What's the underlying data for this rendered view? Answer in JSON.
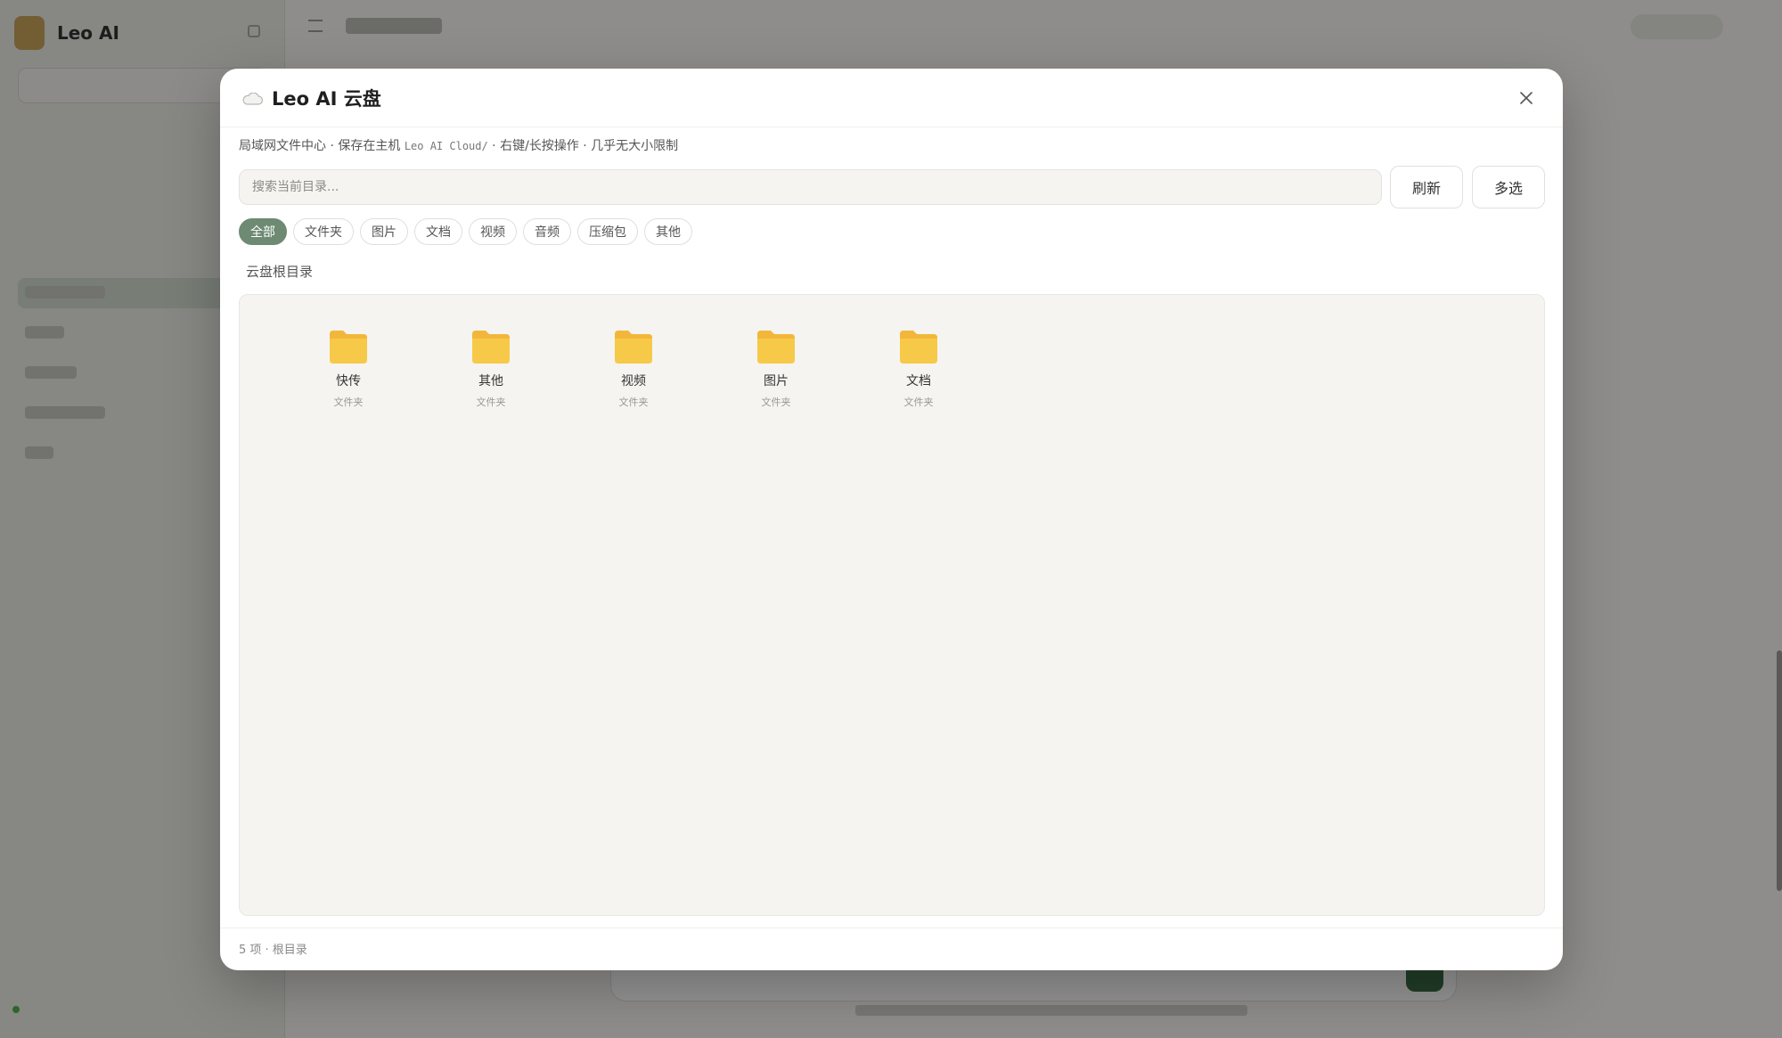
{
  "modal": {
    "title": "Leo AI 云盘",
    "subtitle_prefix": "局域网文件中心 · 保存在主机 ",
    "subtitle_path": "Leo AI Cloud/",
    "subtitle_suffix": " · 右键/长按操作 · 几乎无大小限制",
    "search": {
      "placeholder": "搜索当前目录...",
      "value": ""
    },
    "refresh_label": "刷新",
    "multi_select_label": "多选",
    "filters": [
      "全部",
      "文件夹",
      "图片",
      "文档",
      "视频",
      "音频",
      "压缩包",
      "其他"
    ],
    "active_filter": "全部",
    "breadcrumb": "云盘根目录",
    "items": [
      {
        "name": "快传",
        "type": "文件夹",
        "icon": "folder-icon"
      },
      {
        "name": "其他",
        "type": "文件夹",
        "icon": "folder-icon"
      },
      {
        "name": "视频",
        "type": "文件夹",
        "icon": "folder-icon"
      },
      {
        "name": "图片",
        "type": "文件夹",
        "icon": "folder-icon"
      },
      {
        "name": "文档",
        "type": "文件夹",
        "icon": "folder-icon"
      }
    ],
    "footer": "5 项 · 根目录"
  },
  "background": {
    "brand": "Leo AI"
  },
  "colors": {
    "accent": "#6e8a72",
    "folder": "#f7c948",
    "folder_tab": "#f2b73a",
    "overlay": "rgba(0,0,0,0.42)"
  }
}
